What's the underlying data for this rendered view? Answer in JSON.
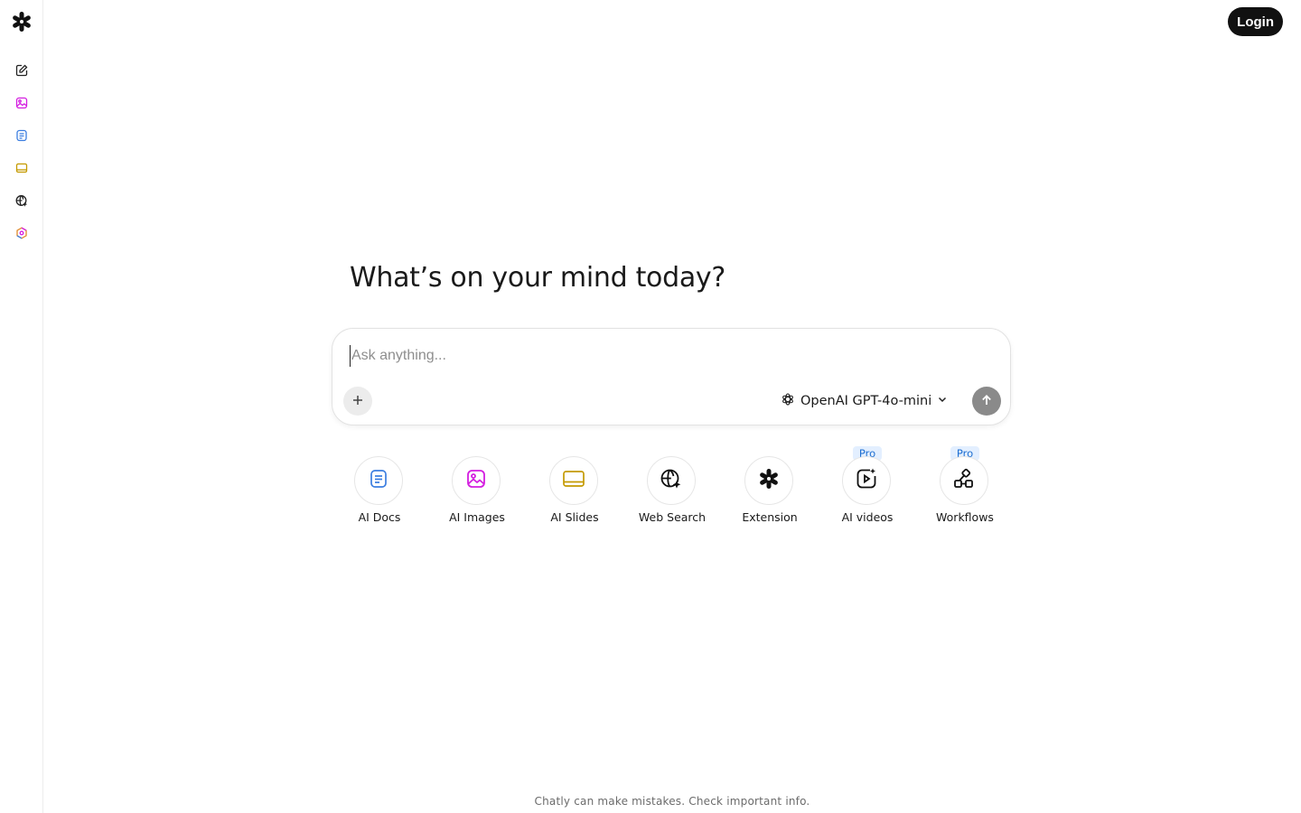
{
  "header": {
    "login_label": "Login"
  },
  "sidebar": {
    "logo_icon": "asterisk-logo-icon",
    "items": [
      {
        "icon": "new-chat-icon",
        "color": "#222222"
      },
      {
        "icon": "image-icon",
        "color": "#d41ee0"
      },
      {
        "icon": "document-icon",
        "color": "#3b7ee0"
      },
      {
        "icon": "slides-icon",
        "color": "#c49a00"
      },
      {
        "icon": "web-search-icon",
        "color": "#222222"
      },
      {
        "icon": "extension-icon",
        "color": "#e08a2a"
      }
    ]
  },
  "main": {
    "headline": "What’s on your mind today?",
    "composer": {
      "placeholder": "Ask anything...",
      "value": "",
      "model_label": "OpenAI GPT-4o-mini"
    },
    "tools": [
      {
        "label": "AI Docs",
        "icon": "docs-icon",
        "color": "#3b7ee0",
        "badge": ""
      },
      {
        "label": "AI Images",
        "icon": "image-icon",
        "color": "#d41ee0",
        "badge": ""
      },
      {
        "label": "AI Slides",
        "icon": "slides-icon",
        "color": "#c49a00",
        "badge": ""
      },
      {
        "label": "Web Search",
        "icon": "web-search-icon",
        "color": "#111111",
        "badge": ""
      },
      {
        "label": "Extension",
        "icon": "asterisk-icon",
        "color": "#111111",
        "badge": ""
      },
      {
        "label": "AI videos",
        "icon": "video-icon",
        "color": "#111111",
        "badge": "Pro"
      },
      {
        "label": "Workflows",
        "icon": "workflow-icon",
        "color": "#111111",
        "badge": "Pro"
      }
    ]
  },
  "footer": {
    "disclaimer": "Chatly can make mistakes. Check important info."
  },
  "colors": {
    "accent_dark": "#111111",
    "pro_badge_bg": "#e3efff",
    "pro_badge_text": "#1f6fd1",
    "send_button": "#8a8a8a"
  }
}
